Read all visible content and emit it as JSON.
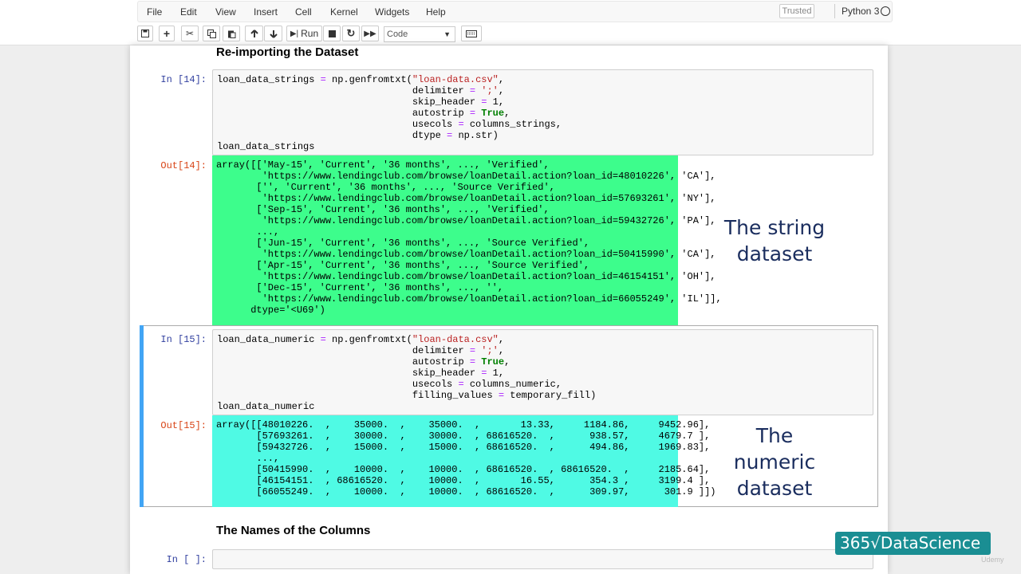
{
  "menu": [
    "File",
    "Edit",
    "View",
    "Insert",
    "Cell",
    "Kernel",
    "Widgets",
    "Help"
  ],
  "trusted": "Trusted",
  "kernel_name": "Python 3",
  "toolbar": {
    "run_label": "Run",
    "cell_type": "Code"
  },
  "section1_title": "Re-importing the Dataset",
  "cell14": {
    "in_prompt": "In [14]:",
    "out_prompt": "Out[14]:",
    "code": [
      "loan_data_strings = np.genfromtxt(\"loan-data.csv\",",
      "                                  delimiter = ';',",
      "                                  skip_header = 1,",
      "                                  autostrip = True,",
      "                                  usecols = columns_strings,",
      "                                  dtype = np.str)",
      "loan_data_strings"
    ],
    "output": [
      "array([['May-15', 'Current', '36 months', ..., 'Verified',",
      "        'https://www.lendingclub.com/browse/loanDetail.action?loan_id=48010226', 'CA'],",
      "       ['', 'Current', '36 months', ..., 'Source Verified',",
      "        'https://www.lendingclub.com/browse/loanDetail.action?loan_id=57693261', 'NY'],",
      "       ['Sep-15', 'Current', '36 months', ..., 'Verified',",
      "        'https://www.lendingclub.com/browse/loanDetail.action?loan_id=59432726', 'PA'],",
      "       ...,",
      "       ['Jun-15', 'Current', '36 months', ..., 'Source Verified',",
      "        'https://www.lendingclub.com/browse/loanDetail.action?loan_id=50415990', 'CA'],",
      "       ['Apr-15', 'Current', '36 months', ..., 'Source Verified',",
      "        'https://www.lendingclub.com/browse/loanDetail.action?loan_id=46154151', 'OH'],",
      "       ['Dec-15', 'Current', '36 months', ..., '',",
      "        'https://www.lendingclub.com/browse/loanDetail.action?loan_id=66055249', 'IL']],",
      "      dtype='<U69')"
    ],
    "caption": [
      "The string",
      "dataset"
    ]
  },
  "cell15": {
    "in_prompt": "In [15]:",
    "out_prompt": "Out[15]:",
    "code": [
      "loan_data_numeric = np.genfromtxt(\"loan-data.csv\",",
      "                                  delimiter = ';',",
      "                                  autostrip = True,",
      "                                  skip_header = 1,",
      "                                  usecols = columns_numeric,",
      "                                  filling_values = temporary_fill)",
      "loan_data_numeric"
    ],
    "output": [
      "array([[48010226.  ,    35000.  ,    35000.  ,       13.33,     1184.86,     9452.96],",
      "       [57693261.  ,    30000.  ,    30000.  , 68616520.  ,      938.57,     4679.7 ],",
      "       [59432726.  ,    15000.  ,    15000.  , 68616520.  ,      494.86,     1969.83],",
      "       ...,",
      "       [50415990.  ,    10000.  ,    10000.  , 68616520.  , 68616520.  ,     2185.64],",
      "       [46154151.  , 68616520.  ,    10000.  ,       16.55,      354.3 ,     3199.4 ],",
      "       [66055249.  ,    10000.  ,    10000.  , 68616520.  ,      309.97,      301.9 ]])"
    ],
    "caption": [
      "The",
      "numeric",
      "dataset"
    ]
  },
  "section2_title": "The Names of the Columns",
  "cell_empty": {
    "in_prompt": "In [ ]:"
  },
  "logo": "365√DataScience",
  "watermark": "Udemy",
  "colors": {
    "string_output_bg": "#3dfd8c",
    "numeric_output_bg": "#4ffae4",
    "caption": "#1a2d5e",
    "logo_bg": "#1a8e93",
    "selected_bar": "#42a5f5"
  }
}
